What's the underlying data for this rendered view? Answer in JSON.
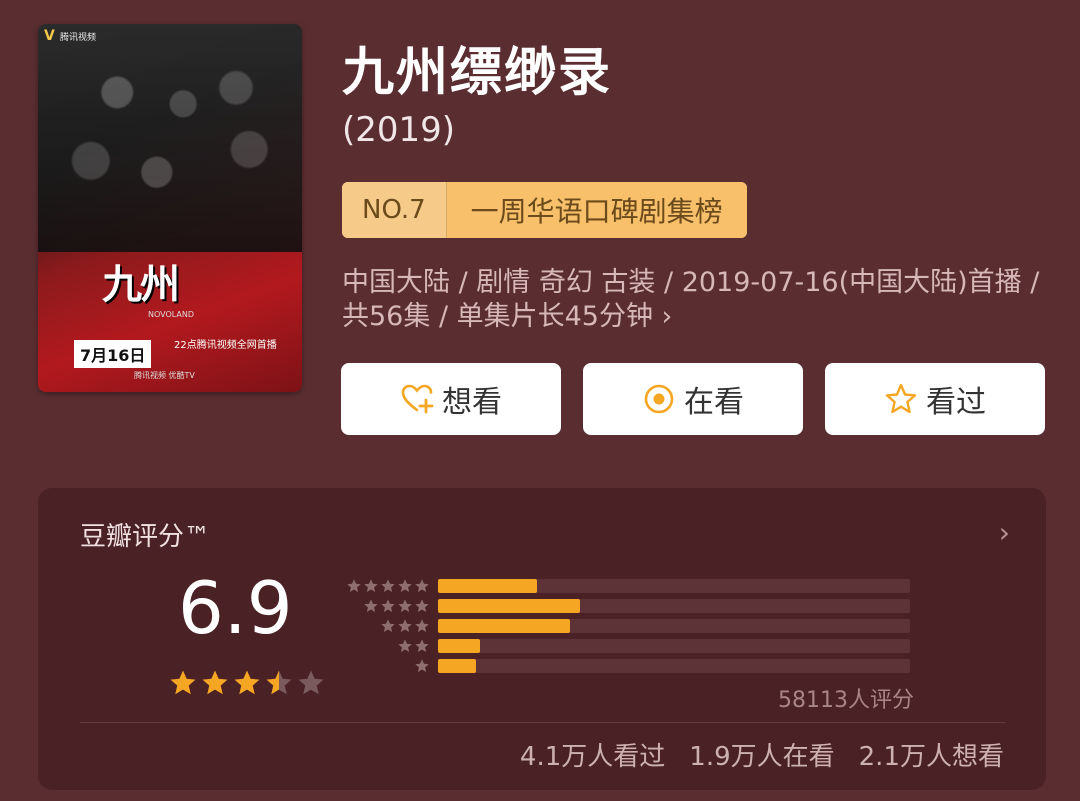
{
  "poster": {
    "logo": "V",
    "brand": "腾讯视频",
    "title_art": "九州",
    "eng_title": "NOVOLAND",
    "date": "7月16日",
    "slogan_line1": "22点腾讯视频全网首播",
    "footer": "腾讯视频  优酷TV"
  },
  "title": "九州缥缈录",
  "year": "(2019)",
  "rank": {
    "no": "NO.7",
    "name": "一周华语口碑剧集榜"
  },
  "meta": "中国大陆 / 剧情 奇幻 古装 / 2019-07-16(中国大陆)首播 / 共56集 / 单集片长45分钟 ›",
  "actions": {
    "want": "想看",
    "watching": "在看",
    "watched": "看过"
  },
  "rating": {
    "label": "豆瓣评分™",
    "score": "6.9",
    "stars": 3.5,
    "distribution": [
      {
        "stars": 5,
        "fraction": 0.21
      },
      {
        "stars": 4,
        "fraction": 0.3
      },
      {
        "stars": 3,
        "fraction": 0.28
      },
      {
        "stars": 2,
        "fraction": 0.09
      },
      {
        "stars": 1,
        "fraction": 0.08
      }
    ],
    "count": "58113人评分",
    "watched": "4.1万人看过",
    "watching": "1.9万人在看",
    "want": "2.1万人想看"
  },
  "colors": {
    "accent": "#f5a623",
    "background": "#5a2e31",
    "card": "#4a2226"
  }
}
